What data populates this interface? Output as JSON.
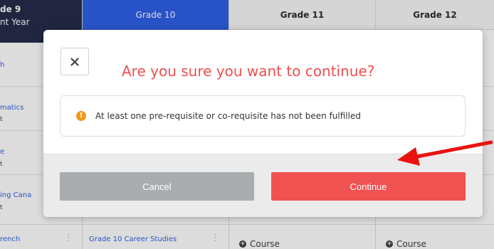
{
  "grid": {
    "columns": [
      {
        "header": "de 9",
        "subheader": "nt Year"
      },
      {
        "header": "Grade 10"
      },
      {
        "header": "Grade 11"
      },
      {
        "header": "Grade 12"
      }
    ],
    "col9_cells": [
      {
        "title": "h"
      },
      {
        "title": "matics",
        "sub": "t"
      },
      {
        "title": "e",
        "sub": "t"
      },
      {
        "title": "ing Cana",
        "sub": "t"
      },
      {
        "title": "rench"
      }
    ],
    "col10_bottom": {
      "title": "Grade 10 Career Studies"
    },
    "course_add_label": "Course"
  },
  "modal": {
    "close_icon": "close-icon",
    "title": "Are you sure you want to continue?",
    "alert_icon": "warning-icon",
    "alert_icon_glyph": "!",
    "alert_text": "At least one pre-requisite or co-requisite has not been fulfilled",
    "cancel_label": "Cancel",
    "continue_label": "Continue"
  },
  "colors": {
    "accent_red": "#f05151",
    "title_red": "#ef4f4f",
    "cancel_gray": "#a9adb0",
    "grade10_blue": "#2457e6",
    "grade9_navy": "#1b2040",
    "warning_orange": "#f39a1b"
  }
}
